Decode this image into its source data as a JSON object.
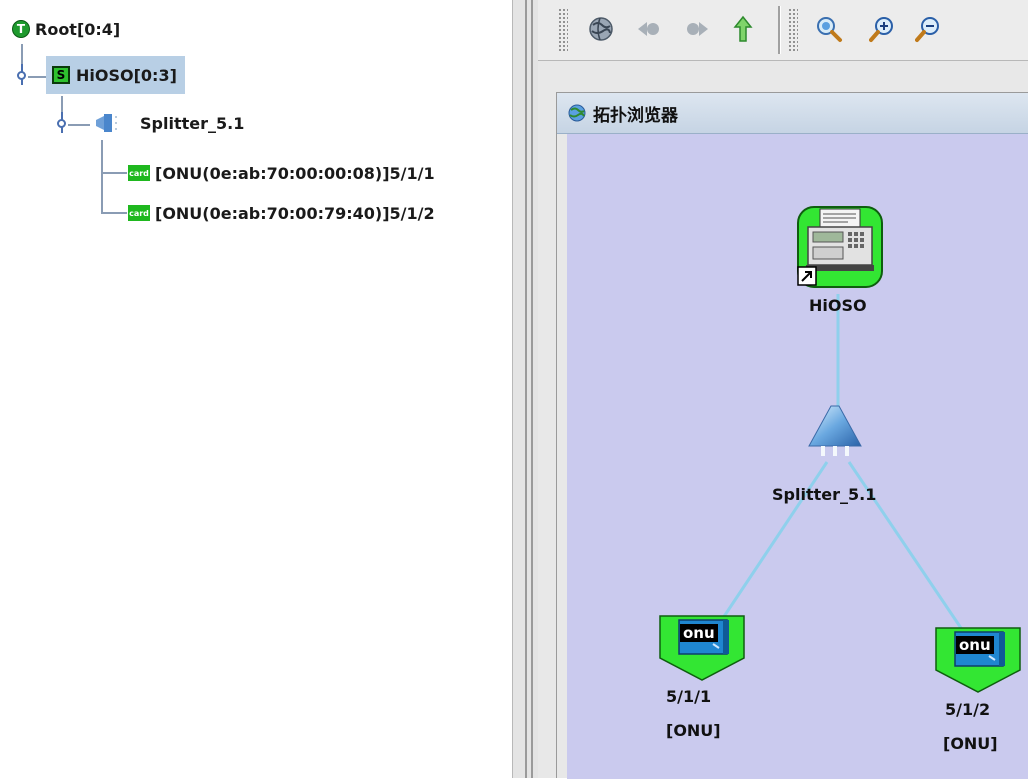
{
  "tree": {
    "root": {
      "label": "Root[0:4]",
      "icon": "T"
    },
    "device": {
      "label": "HiOSO[0:3]",
      "icon": "S"
    },
    "splitter": {
      "label": "Splitter_5.1"
    },
    "onus": [
      {
        "icon": "card",
        "label": "[ONU(0e:ab:70:00:00:08)]5/1/1"
      },
      {
        "icon": "card",
        "label": "[ONU(0e:ab:70:00:79:40)]5/1/2"
      }
    ]
  },
  "toolbar": {
    "buttons": [
      "globe-icon",
      "back-icon",
      "forward-icon",
      "up-icon",
      "zoom-fit-icon",
      "zoom-in-icon",
      "zoom-out-icon"
    ]
  },
  "topology": {
    "title": "拓扑浏览器",
    "olt": {
      "label": "HiOSO"
    },
    "splitter": {
      "label": "Splitter_5.1"
    },
    "onus": [
      {
        "badge": "onu",
        "port": "5/1/1",
        "type": "[ONU]"
      },
      {
        "badge": "onu",
        "port": "5/1/2",
        "type": "[ONU]"
      }
    ]
  },
  "colors": {
    "canvas": "#cacaee",
    "link": "#8fd0ec",
    "onu_body": "#33e633",
    "selection": "#b8cfe5"
  }
}
